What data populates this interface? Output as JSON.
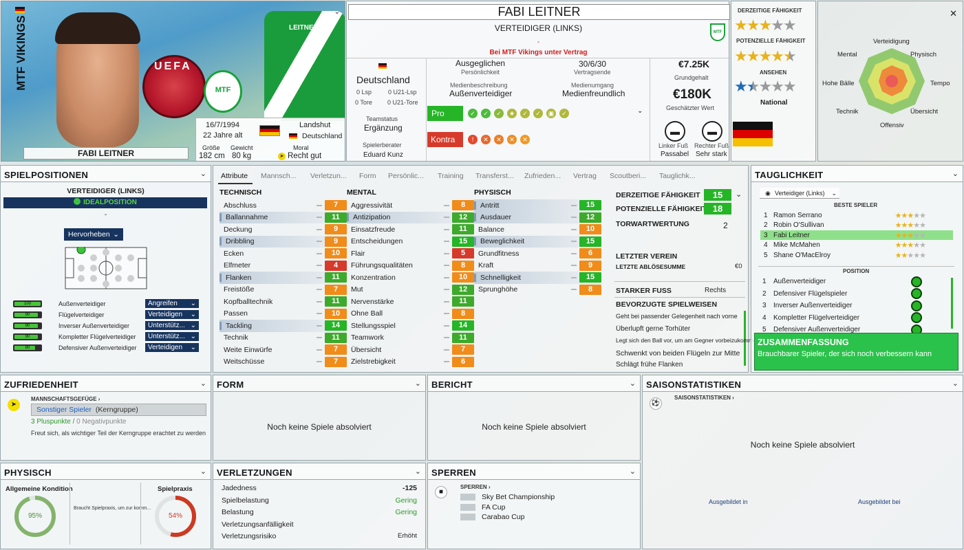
{
  "header": {
    "club_vertical": "MTF VIKINGS",
    "player_name_photo": "FABI LEITNER",
    "shirt_name": "LEITNER",
    "name": "FABI LEITNER",
    "role": "VERTEIDIGER (LINKS)",
    "dash": "-",
    "contract_note": "Bei MTF Vikings unter Vertrag",
    "dob": "16/7/1994",
    "age": "22 Jahre alt",
    "birthplace_label": "Landshut",
    "nation_small": "Deutschland",
    "height_label": "Größe",
    "height": "182 cm",
    "weight_label": "Gewicht",
    "weight": "80 kg",
    "moral_label": "Moral",
    "moral": "Recht gut",
    "nation": "Deutschland",
    "lsp": "0 Lsp",
    "u21lsp": "0 U21-Lsp",
    "tore": "0 Tore",
    "u21tore": "0 U21-Tore",
    "teamstatus_label": "Teamstatus",
    "teamstatus": "Ergänzung",
    "agent_label": "Spielerberater",
    "agent": "Eduard Kunz",
    "personality": "Ausgeglichen",
    "personality_label": "Persönlichkeit",
    "contract_end": "30/6/30",
    "contract_end_label": "Vertragsende",
    "media_desc_label": "Medienbeschreibung",
    "media_desc": "Außenverteidiger",
    "media_handling_label": "Medienumgang",
    "media_handling": "Medienfreundlich",
    "pro_label": "Pro",
    "contra_label": "Kontra",
    "wage": "€7.25K",
    "wage_label": "Grundgehalt",
    "value": "€180K",
    "value_label": "Geschätzter Wert",
    "left_foot_label": "Linker Fuß",
    "left_foot": "Passabel",
    "right_foot_label": "Rechter Fuß",
    "right_foot": "Sehr stark",
    "ability_label": "DERZEITIGE FÄHIGKEIT",
    "potential_label": "POTENZIELLE FÄHIGKEIT",
    "reputation_label": "ANSEHEN",
    "reputation_level": "National",
    "ability_stars": 3,
    "potential_stars": 4.5,
    "reputation_stars": 1.5,
    "radar_labels": {
      "verteidigung": "Verteidigung",
      "physisch": "Physisch",
      "tempo": "Tempo",
      "ubersicht": "Übersicht",
      "offensiv": "Offensiv",
      "technik": "Technik",
      "hohe_balle": "Hohe Bälle",
      "mental": "Mental"
    }
  },
  "positions": {
    "title": "SPIELPOSITIONEN",
    "role": "VERTEIDIGER (LINKS)",
    "ideal": "IDEALPOSITION",
    "dash": "-",
    "highlight": "Hervorheben",
    "rows": [
      {
        "rating": "100",
        "fill": 1.0,
        "name": "Außenverteidiger",
        "duty": "Angreifen"
      },
      {
        "rating": "90",
        "fill": 0.9,
        "name": "Flügelverteidiger",
        "duty": "Verteidigen"
      },
      {
        "rating": "90",
        "fill": 0.9,
        "name": "Inverser Außenverteidiger",
        "duty": "Unterstütz..."
      },
      {
        "rating": "90",
        "fill": 0.9,
        "name": "Kompletter Flügelverteidiger",
        "duty": "Unterstütz..."
      },
      {
        "rating": "80",
        "fill": 0.8,
        "name": "Defensiver Außenverteidiger",
        "duty": "Verteidigen"
      }
    ]
  },
  "tabs": [
    "Attribute",
    "Mannsch...",
    "Verletzun...",
    "Form",
    "Persönlic...",
    "Training",
    "Transferst...",
    "Zufrieden...",
    "Vertrag",
    "Scoutberi...",
    "Tauglichk..."
  ],
  "attributes": {
    "technisch_label": "TECHNISCH",
    "mental_label": "MENTAL",
    "physisch_label": "PHYSISCH",
    "technisch": [
      {
        "name": "Abschluss",
        "value": "7"
      },
      {
        "name": "Ballannahme",
        "value": "11"
      },
      {
        "name": "Deckung",
        "value": "9"
      },
      {
        "name": "Dribbling",
        "value": "9"
      },
      {
        "name": "Ecken",
        "value": "10"
      },
      {
        "name": "Elfmeter",
        "value": "4"
      },
      {
        "name": "Flanken",
        "value": "11"
      },
      {
        "name": "Freistöße",
        "value": "7"
      },
      {
        "name": "Kopfballtechnik",
        "value": "11"
      },
      {
        "name": "Passen",
        "value": "10"
      },
      {
        "name": "Tackling",
        "value": "14"
      },
      {
        "name": "Technik",
        "value": "11"
      },
      {
        "name": "Weite Einwürfe",
        "value": "7"
      },
      {
        "name": "Weitschüsse",
        "value": "7"
      }
    ],
    "mental": [
      {
        "name": "Aggressivität",
        "value": "8"
      },
      {
        "name": "Antizipation",
        "value": "12"
      },
      {
        "name": "Einsatzfreude",
        "value": "11"
      },
      {
        "name": "Entscheidungen",
        "value": "15"
      },
      {
        "name": "Flair",
        "value": "5"
      },
      {
        "name": "Führungsqualitäten",
        "value": "8"
      },
      {
        "name": "Konzentration",
        "value": "10"
      },
      {
        "name": "Mut",
        "value": "12"
      },
      {
        "name": "Nervenstärke",
        "value": "11"
      },
      {
        "name": "Ohne Ball",
        "value": "8"
      },
      {
        "name": "Stellungsspiel",
        "value": "14"
      },
      {
        "name": "Teamwork",
        "value": "11"
      },
      {
        "name": "Übersicht",
        "value": "7"
      },
      {
        "name": "Zielstrebigkeit",
        "value": "6"
      }
    ],
    "physisch": [
      {
        "name": "Antritt",
        "value": "15"
      },
      {
        "name": "Ausdauer",
        "value": "12"
      },
      {
        "name": "Balance",
        "value": "10"
      },
      {
        "name": "Beweglichkeit",
        "value": "15"
      },
      {
        "name": "Grundfitness",
        "value": "6"
      },
      {
        "name": "Kraft",
        "value": "9"
      },
      {
        "name": "Schnelligkeit",
        "value": "15"
      },
      {
        "name": "Sprunghöhe",
        "value": "8"
      }
    ],
    "side": {
      "ability_label": "DERZEITIGE FÄHIGKEIT",
      "ability": "15",
      "potential_label": "POTENZIELLE FÄHIGKEIT",
      "potential": "18",
      "gk_label": "TORWARTWERTUNG",
      "gk": "2",
      "last_club_label": "LETZTER VEREIN",
      "last_fee_label": "LETZTE ABLÖSESUMME",
      "last_fee": "€0",
      "strong_foot_label": "STARKER FUSS",
      "strong_foot": "Rechts",
      "ppm_label": "BEVORZUGTE SPIELWEISEN",
      "ppms": [
        "Geht bei passender Gelegenheit nach vorne",
        "Überlupft gerne Torhüter",
        "Legt sich den Ball vor, um am Gegner vorbeizukommen",
        "Schwenkt von beiden Flügeln zur Mitte",
        "Schlägt frühe Flanken"
      ]
    }
  },
  "tauglichkeit": {
    "title": "TAUGLICHKEIT",
    "role_select": "Verteidiger (Links)",
    "best_label": "BESTE SPIELER",
    "best": [
      {
        "no": "1",
        "name": "Ramon Serrano",
        "stars": 3
      },
      {
        "no": "2",
        "name": "Robin O'Sullivan",
        "stars": 3
      },
      {
        "no": "3",
        "name": "Fabi Leitner",
        "stars": 3
      },
      {
        "no": "4",
        "name": "Mike McMahen",
        "stars": 3
      },
      {
        "no": "5",
        "name": "Shane O'MacElroy",
        "stars": 2
      }
    ],
    "position_label": "POSITION",
    "positions": [
      {
        "no": "1",
        "name": "Außenverteidiger"
      },
      {
        "no": "2",
        "name": "Defensiver Flügelspieler"
      },
      {
        "no": "3",
        "name": "Inverser Außenverteidiger"
      },
      {
        "no": "4",
        "name": "Kompletter Flügelverteidiger"
      },
      {
        "no": "5",
        "name": "Defensiver Außenverteidiger"
      }
    ],
    "summary_title": "ZUSAMMENFASSUNG",
    "summary_text": "Brauchbarer Spieler, der sich noch verbessern kann"
  },
  "zufriedenheit": {
    "title": "ZUFRIEDENHEIT",
    "link": "MANNSCHAFTSGEFÜGE",
    "status": "Sonstiger Spieler",
    "group": "(Kerngruppe)",
    "plus": "3 Pluspunkte",
    "sep": "/",
    "minus": "0 Negativpunkte",
    "desc": "Freut sich, als wichtiger Teil der Kerngruppe erachtet zu werden"
  },
  "form": {
    "title": "FORM",
    "empty": "Noch keine Spiele absolviert"
  },
  "bericht": {
    "title": "BERICHT",
    "empty": "Noch keine Spiele absolviert"
  },
  "saison": {
    "title": "SAISONSTATISTIKEN",
    "link": "SAISONSTATISTIKEN",
    "empty": "Noch keine Spiele absolviert",
    "trained_in": "Ausgebildet in",
    "trained_at": "Ausgebildet bei"
  },
  "physisch": {
    "title": "PHYSISCH",
    "condition_label": "Allgemeine Kondition",
    "condition": "95%",
    "condition_value": 0.95,
    "note": "Braucht Spielpraxis, um zur komm...",
    "practice_label": "Spielpraxis",
    "practice": "54%",
    "practice_value": 0.54
  },
  "verletzungen": {
    "title": "VERLETZUNGEN",
    "rows": [
      {
        "label": "Jadedness",
        "value": "-125"
      },
      {
        "label": "Spielbelastung",
        "value": "Gering"
      },
      {
        "label": "Belastung",
        "value": "Gering"
      },
      {
        "label": "Verletzungsanfälligkeit",
        "value": ""
      },
      {
        "label": "Verletzungsrisiko",
        "value": "Erhöht"
      }
    ]
  },
  "sperren": {
    "title": "SPERREN",
    "link": "SPERREN",
    "items": [
      "Sky Bet Championship",
      "FA Cup",
      "Carabao Cup"
    ]
  },
  "colors": {
    "navy": "#17345e",
    "green": "#25b526",
    "red": "#d63a2b",
    "orange": "#f08c1a",
    "gold": "#e8b21c"
  }
}
